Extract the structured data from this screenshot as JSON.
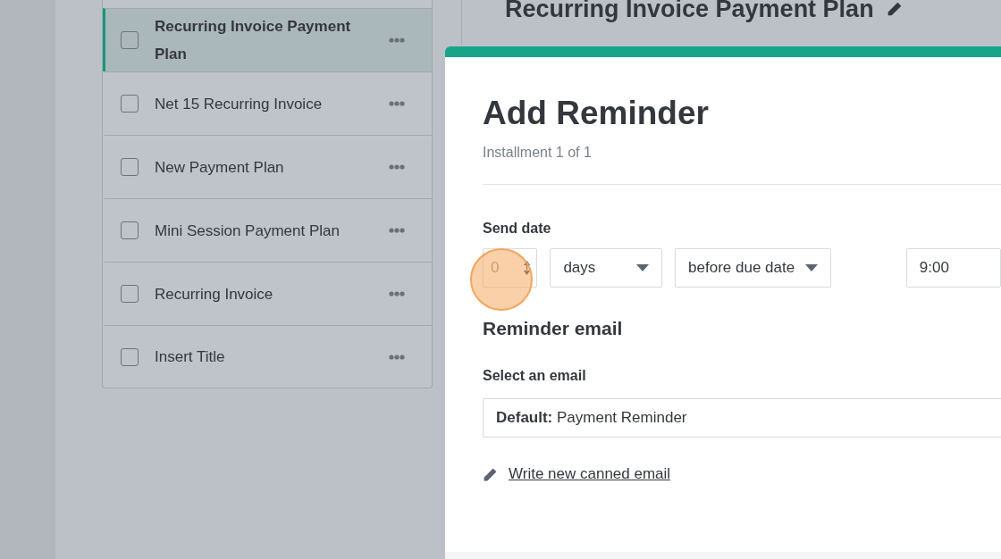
{
  "plans": {
    "items": [
      {
        "label": "Recurring Invoice Payment Plan",
        "checked": false,
        "selected": true
      },
      {
        "label": "Net 15 Recurring Invoice",
        "checked": false,
        "selected": false
      },
      {
        "label": "New Payment Plan",
        "checked": false,
        "selected": false
      },
      {
        "label": "Mini Session Payment Plan",
        "checked": false,
        "selected": false
      },
      {
        "label": "Recurring Invoice",
        "checked": false,
        "selected": false
      },
      {
        "label": "Insert Title",
        "checked": false,
        "selected": false
      }
    ]
  },
  "page_title": "Recurring Invoice Payment Plan",
  "modal": {
    "title": "Add Reminder",
    "subtitle": "Installment 1 of 1",
    "send_date": {
      "label": "Send date",
      "amount": "0",
      "unit": "days",
      "relation": "before due date",
      "time": "9:00"
    },
    "reminder_email": {
      "heading": "Reminder email",
      "label": "Select an email",
      "value": "**Default:** Payment Reminder",
      "link": "Write new canned email"
    }
  }
}
